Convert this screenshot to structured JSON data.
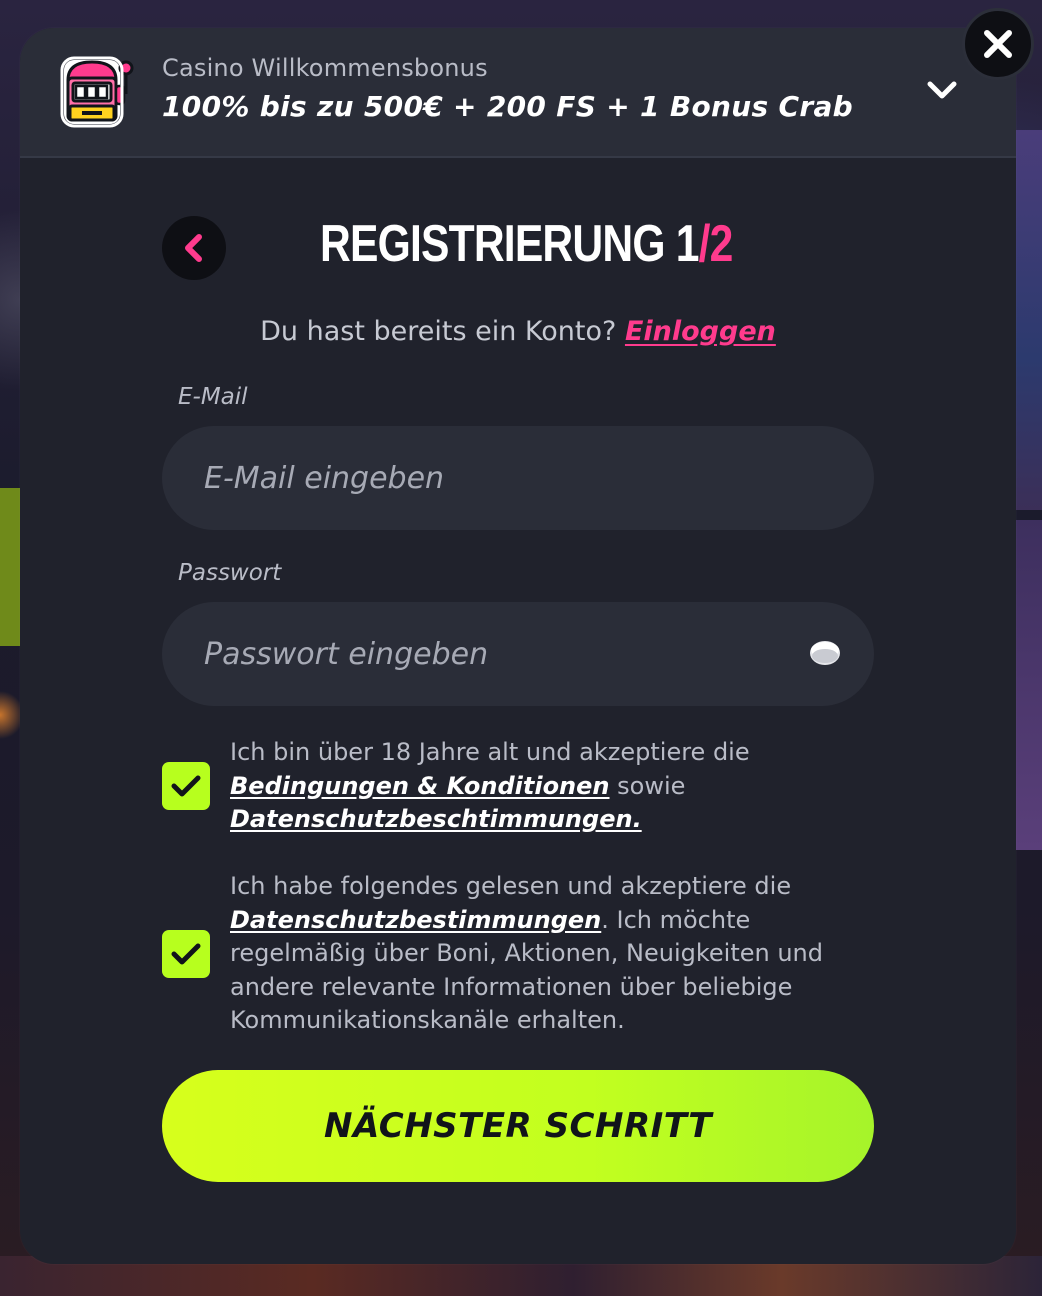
{
  "bonus": {
    "label": "Casino Willkommensbonus",
    "title": "100% bis zu 500€ + 200 FS + 1 Bonus Crab",
    "icon": "slot-machine-icon",
    "toggle_icon": "chevron-down-icon"
  },
  "close_icon": "close-icon",
  "header": {
    "back_icon": "chevron-left-icon",
    "title_prefix": "REGISTRIERUNG 1",
    "title_slash": "/",
    "title_total": "2"
  },
  "login": {
    "prompt": "Du hast bereits ein Konto? ",
    "link_label": "Einloggen"
  },
  "email": {
    "label": "E-Mail",
    "placeholder": "E-Mail eingeben",
    "value": ""
  },
  "password": {
    "label": "Passwort",
    "placeholder": "Passwort eingeben",
    "value": "",
    "toggle_icon": "eye-icon"
  },
  "consent1": {
    "checked": true,
    "text_before": "Ich bin über 18 Jahre alt und akzeptiere die ",
    "terms_link": "Bedingungen & Konditionen",
    "text_middle": " sowie ",
    "privacy_link": "Datenschutzbeschtimmungen."
  },
  "consent2": {
    "checked": true,
    "text_before": "Ich habe folgendes gelesen und akzeptiere die ",
    "privacy_link": "Datenschutzbestimmungen",
    "text_after": ". Ich möchte regelmäßig über Boni, Aktionen, Neuigkeiten und andere relevante Informationen über beliebige Kommunikationskanäle erhalten."
  },
  "next_button": {
    "label": "NÄCHSTER SCHRITT"
  },
  "colors": {
    "accent_pink": "#ff3b8d",
    "accent_lime": "#b7ff1e",
    "panel": "#20222c",
    "input_bg": "#2a2d38"
  }
}
